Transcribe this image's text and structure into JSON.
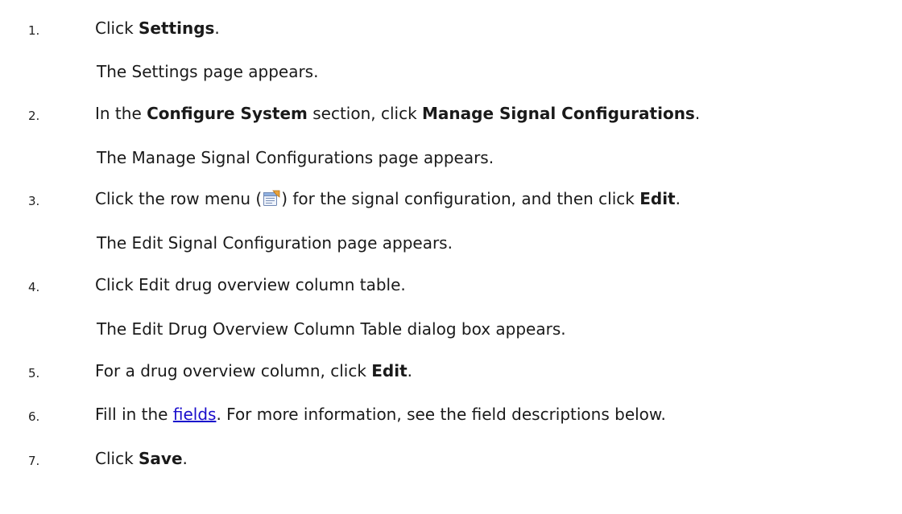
{
  "steps": [
    {
      "number": "1.",
      "parts": [
        "Click ",
        "Settings",
        "."
      ],
      "result": "The Settings page appears."
    },
    {
      "number": "2.",
      "parts": [
        "In the ",
        "Configure System",
        " section, click ",
        "Manage Signal Configurations",
        "."
      ],
      "result": "The Manage Signal Configurations page appears."
    },
    {
      "number": "3.",
      "parts": [
        "Click the row menu (",
        ") for the signal configuration, and then click ",
        "Edit",
        "."
      ],
      "icon": "row-menu-icon",
      "result": "The Edit Signal Configuration page appears."
    },
    {
      "number": "4.",
      "parts": [
        "Click Edit drug overview column table."
      ],
      "result": "The Edit Drug Overview Column Table dialog box appears."
    },
    {
      "number": "5.",
      "parts": [
        "For a drug overview column, click ",
        "Edit",
        "."
      ]
    },
    {
      "number": "6.",
      "parts": [
        "Fill in the ",
        "fields",
        ". For more information, see the field descriptions below."
      ]
    },
    {
      "number": "7.",
      "parts": [
        "Click ",
        "Save",
        "."
      ]
    }
  ],
  "colors": {
    "text": "#1a1a1a",
    "link": "#1a0dcc"
  }
}
